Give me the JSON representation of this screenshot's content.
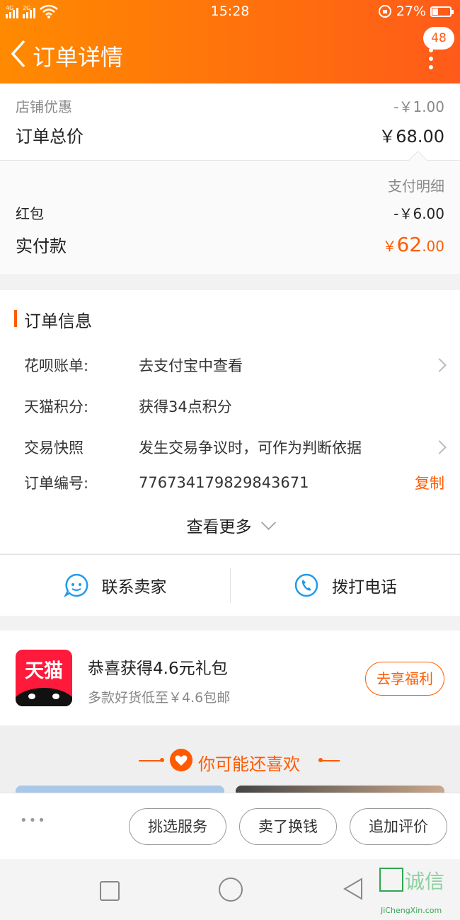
{
  "status_bar": {
    "time": "15:28",
    "battery": "27%",
    "net1": "4G",
    "net2": "2G"
  },
  "nav": {
    "title": "订单详情",
    "badge": "48"
  },
  "price": {
    "shop_discount_label": "店铺优惠",
    "shop_discount_value": "-￥1.00",
    "total_label": "订单总价",
    "total_value": "￥68.00",
    "detail_link": "支付明细",
    "redpacket_label": "红包",
    "redpacket_value": "-￥6.00",
    "paid_label": "实付款",
    "paid_currency": "￥",
    "paid_int": "62",
    "paid_dec": ".00"
  },
  "order_info": {
    "title": "订单信息",
    "rows": [
      {
        "key": "花呗账单:",
        "value": "去支付宝中查看"
      },
      {
        "key": "天猫积分:",
        "value": "获得34点积分"
      },
      {
        "key": "交易快照",
        "value": "发生交易争议时，可作为判断依据"
      },
      {
        "key": "订单编号:",
        "value": "776734179829843671",
        "action": "复制"
      }
    ],
    "more": "查看更多"
  },
  "contact": {
    "seller": "联系卖家",
    "phone": "拨打电话"
  },
  "promo": {
    "logo": "天猫",
    "title": "恭喜获得4.6元礼包",
    "subtitle": "多款好货低至￥4.6包邮",
    "button": "去享福利"
  },
  "recommend": {
    "title": "你可能还喜欢"
  },
  "bottom_bar": {
    "dots": "•••",
    "btn1": "挑选服务",
    "btn2": "卖了换钱",
    "btn3": "追加评价"
  },
  "watermark": {
    "text": "诚信",
    "url": "JiChengXin.com"
  },
  "colors": {
    "accent": "#ff5a00",
    "header_start": "#ff8a00",
    "header_end": "#ff5a1a",
    "blue": "#1e9be9",
    "tmall_red": "#ff1a3c"
  }
}
